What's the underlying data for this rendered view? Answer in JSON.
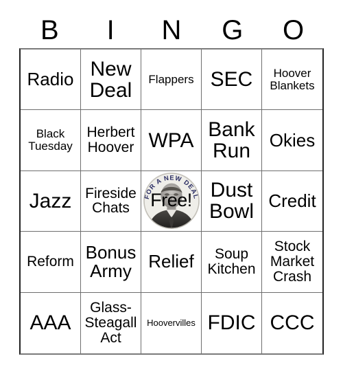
{
  "header": {
    "letters": [
      "B",
      "I",
      "N",
      "G",
      "O"
    ]
  },
  "grid": {
    "rows": [
      [
        {
          "label": "Radio",
          "size": "fs-lg"
        },
        {
          "label": "New Deal",
          "size": "fs-xl"
        },
        {
          "label": "Flappers",
          "size": "fs-sm"
        },
        {
          "label": "SEC",
          "size": "fs-xl"
        },
        {
          "label": "Hoover Blankets",
          "size": "fs-sm"
        }
      ],
      [
        {
          "label": "Black Tuesday",
          "size": "fs-sm"
        },
        {
          "label": "Herbert Hoover",
          "size": "fs-md"
        },
        {
          "label": "WPA",
          "size": "fs-xl"
        },
        {
          "label": "Bank Run",
          "size": "fs-xl"
        },
        {
          "label": "Okies",
          "size": "fs-lg"
        }
      ],
      [
        {
          "label": "Jazz",
          "size": "fs-xl"
        },
        {
          "label": "Fireside Chats",
          "size": "fs-md"
        },
        {
          "label": "Free!",
          "size": "free",
          "free_space": true,
          "badge_text": "FOR A NEW DEAL",
          "badge_portrait": "fdr-portrait",
          "badge_text_color": "#2b2e63",
          "badge_background": "#efeee9"
        },
        {
          "label": "Dust Bowl",
          "size": "fs-xl"
        },
        {
          "label": "Credit",
          "size": "fs-lg"
        }
      ],
      [
        {
          "label": "Reform",
          "size": "fs-md"
        },
        {
          "label": "Bonus Army",
          "size": "fs-lg"
        },
        {
          "label": "Relief",
          "size": "fs-lg"
        },
        {
          "label": "Soup Kitchen",
          "size": "fs-md"
        },
        {
          "label": "Stock Market Crash",
          "size": "fs-md"
        }
      ],
      [
        {
          "label": "AAA",
          "size": "fs-xl"
        },
        {
          "label": "Glass-Steagall Act",
          "size": "fs-md"
        },
        {
          "label": "Hoovervilles",
          "size": "fs-xs"
        },
        {
          "label": "FDIC",
          "size": "fs-xl"
        },
        {
          "label": "CCC",
          "size": "fs-xl"
        }
      ]
    ]
  },
  "colors": {
    "background": "#ffffff",
    "text": "#000000",
    "grid_line": "#6e6e6e",
    "grid_border": "#222222"
  }
}
